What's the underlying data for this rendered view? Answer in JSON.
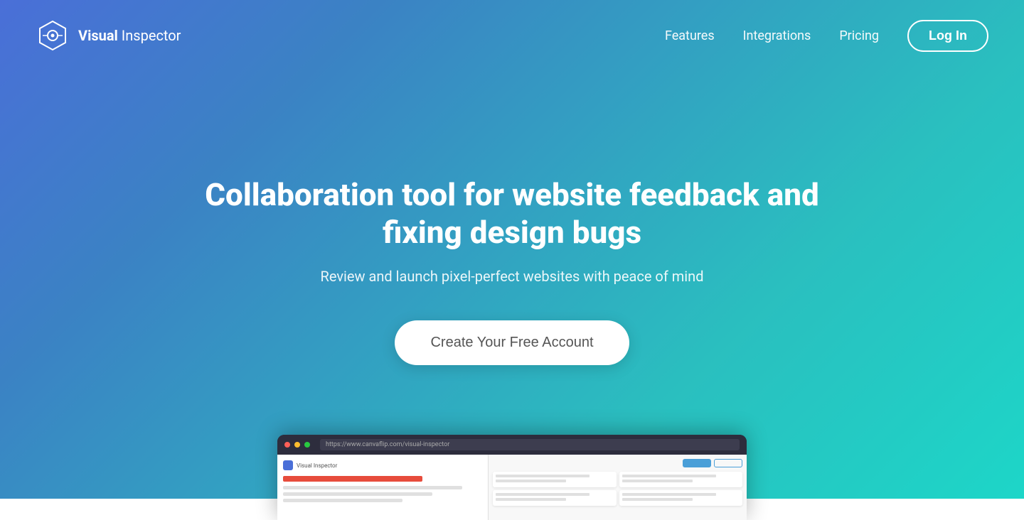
{
  "brand": {
    "name_bold": "Visual",
    "name_regular": " Inspector",
    "logo_alt": "Visual Inspector Logo"
  },
  "nav": {
    "features_label": "Features",
    "integrations_label": "Integrations",
    "pricing_label": "Pricing",
    "login_label": "Log In"
  },
  "hero": {
    "headline": "Collaboration tool for website feedback and fixing design bugs",
    "subheadline": "Review and launch pixel-perfect websites with peace of mind",
    "cta_label": "Create Your Free Account"
  },
  "browser_mockup": {
    "address_text": "https://www.canvaflip.com/visual-inspector"
  }
}
